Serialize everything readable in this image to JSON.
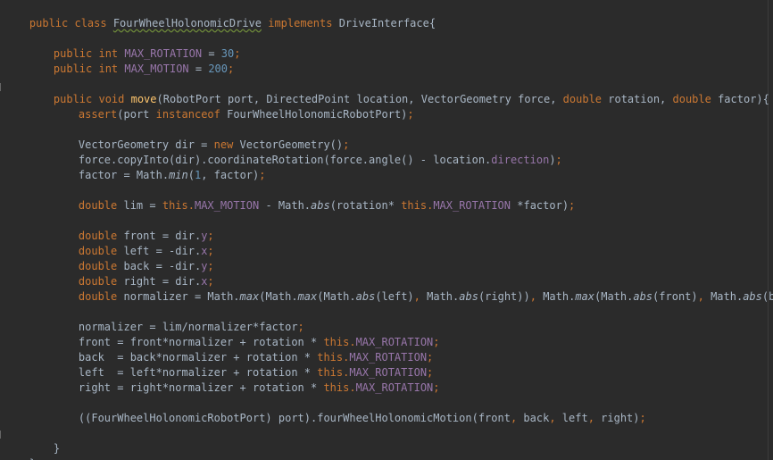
{
  "window": {
    "title": ""
  },
  "code": {
    "l1": {
      "a": "public class ",
      "b": "FourWheelHolonomicDrive",
      "c": " implements ",
      "d": "DriveInterface{"
    },
    "l3": {
      "a": "public int ",
      "b": "MAX_ROTATION",
      "c": " = ",
      "d": "30",
      "e": ";"
    },
    "l4": {
      "a": "public int ",
      "b": "MAX_MOTION",
      "c": " = ",
      "d": "200",
      "e": ";"
    },
    "l6": {
      "a": "public void ",
      "b": "move",
      "c": "(RobotPort port, DirectedPoint location, VectorGeometry force, ",
      "d": "double ",
      "e": "rotation, ",
      "f": "double ",
      "g": "factor){"
    },
    "l7": {
      "a": "assert",
      "b": "(port ",
      "c": "instanceof ",
      "d": "FourWheelHolonomicRobotPort)",
      "e": ";"
    },
    "l9": {
      "a": "VectorGeometry dir = ",
      "b": "new ",
      "c": "VectorGeometry()",
      "d": ";"
    },
    "l10": {
      "a": "force.copyInto(dir).coordinateRotation(force.angle() - location.",
      "b": "direction",
      "c": ")",
      "d": ";"
    },
    "l11": {
      "a": "factor = Math.",
      "b": "min",
      "c": "(",
      "d": "1",
      "e": ", factor)",
      "f": ";"
    },
    "l13": {
      "a": "double ",
      "b": "lim = ",
      "c": "this.",
      "d": "MAX_MOTION",
      "e": " - Math.",
      "f": "abs",
      "g": "(rotation* ",
      "h": "this.",
      "i": "MAX_ROTATION",
      "j": " *factor)",
      "k": ";"
    },
    "l15": {
      "a": "double ",
      "b": "front = dir.",
      "c": "y",
      "d": ";"
    },
    "l16": {
      "a": "double ",
      "b": "left = -dir.",
      "c": "x",
      "d": ";"
    },
    "l17": {
      "a": "double ",
      "b": "back = -dir.",
      "c": "y",
      "d": ";"
    },
    "l18": {
      "a": "double ",
      "b": "right = dir.",
      "c": "x",
      "d": ";"
    },
    "l19": {
      "a": "double ",
      "b": "normalizer = Math.",
      "c": "max",
      "d": "(Math.",
      "e": "max",
      "f": "(Math.",
      "g": "abs",
      "h": "(left)",
      "i": ", ",
      "j": "Math.",
      "k": "abs",
      "l": "(right))",
      "m": ", ",
      "n": "Math.",
      "o": "max",
      "p": "(Math.",
      "q": "abs",
      "r": "(front)",
      "s": ", ",
      "t": "Math.",
      "u": "abs",
      "v": "(back)))",
      "w": ";"
    },
    "l21": {
      "a": "normalizer = lim/normalizer*factor",
      "b": ";"
    },
    "l22": {
      "a": "front = front*normalizer + rotation * ",
      "b": "this.",
      "c": "MAX_ROTATION",
      "d": ";"
    },
    "l23": {
      "a": "back  = back*normalizer + rotation * ",
      "b": "this.",
      "c": "MAX_ROTATION",
      "d": ";"
    },
    "l24": {
      "a": "left  = left*normalizer + rotation * ",
      "b": "this.",
      "c": "MAX_ROTATION",
      "d": ";"
    },
    "l25": {
      "a": "right = right*normalizer + rotation * ",
      "b": "this.",
      "c": "MAX_ROTATION",
      "d": ";"
    },
    "l27": {
      "a": "((FourWheelHolonomicRobotPort) port).fourWheelHolonomicMotion(front",
      "b": ", ",
      "c": "back",
      "d": ", ",
      "e": "left",
      "f": ", ",
      "g": "right)",
      "h": ";"
    },
    "l29": {
      "a": "}"
    },
    "l30": {
      "a": "}"
    }
  },
  "colors": {
    "background": "#2b2b2b",
    "text": "#a9b7c6",
    "keyword": "#cc7832",
    "field": "#9876aa",
    "number": "#6897bb",
    "method": "#ffc66d"
  }
}
